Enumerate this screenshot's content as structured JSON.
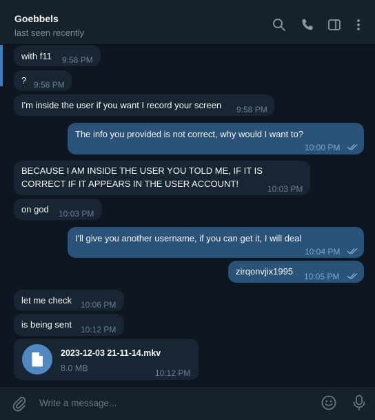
{
  "header": {
    "title": "Goebbels",
    "status": "last seen recently",
    "icons": [
      "search-icon",
      "phone-icon",
      "sidebar-toggle-icon",
      "more-vertical-icon"
    ]
  },
  "messages": [
    {
      "dir": "in",
      "text": "with f11",
      "time": "9:58 PM"
    },
    {
      "dir": "in",
      "text": "?",
      "time": "9:58 PM"
    },
    {
      "dir": "in",
      "text": "I'm inside the user if you want I record your screen",
      "time": "9:58 PM"
    },
    {
      "dir": "out",
      "text": "The info you provided is not correct, why would I want to?",
      "time": "10:00 PM"
    },
    {
      "dir": "in",
      "text": "BECAUSE I AM INSIDE THE USER YOU TOLD ME, IF IT IS CORRECT IF IT APPEARS IN THE USER ACCOUNT!",
      "time": "10:03 PM"
    },
    {
      "dir": "in",
      "text": "on god",
      "time": "10:03 PM"
    },
    {
      "dir": "out",
      "text": "I'll give you another username, if you can get it, I will deal",
      "time": "10:04 PM"
    },
    {
      "dir": "out",
      "text": "zirqonvjix1995",
      "time": "10:05 PM"
    },
    {
      "dir": "in",
      "text": "let me check",
      "time": "10:06 PM"
    },
    {
      "dir": "in",
      "text": "is being sent",
      "time": "10:12 PM"
    }
  ],
  "file_message": {
    "filename": "2023-12-03 21-11-14.mkv",
    "size": "8.0 MB",
    "time": "10:12 PM"
  },
  "composer": {
    "placeholder": "Write a message..."
  },
  "colors": {
    "background": "#0e1621",
    "header": "#17212b",
    "incoming_bubble": "#182533",
    "outgoing_bubble": "#2b5278",
    "accent": "#5288c1"
  }
}
